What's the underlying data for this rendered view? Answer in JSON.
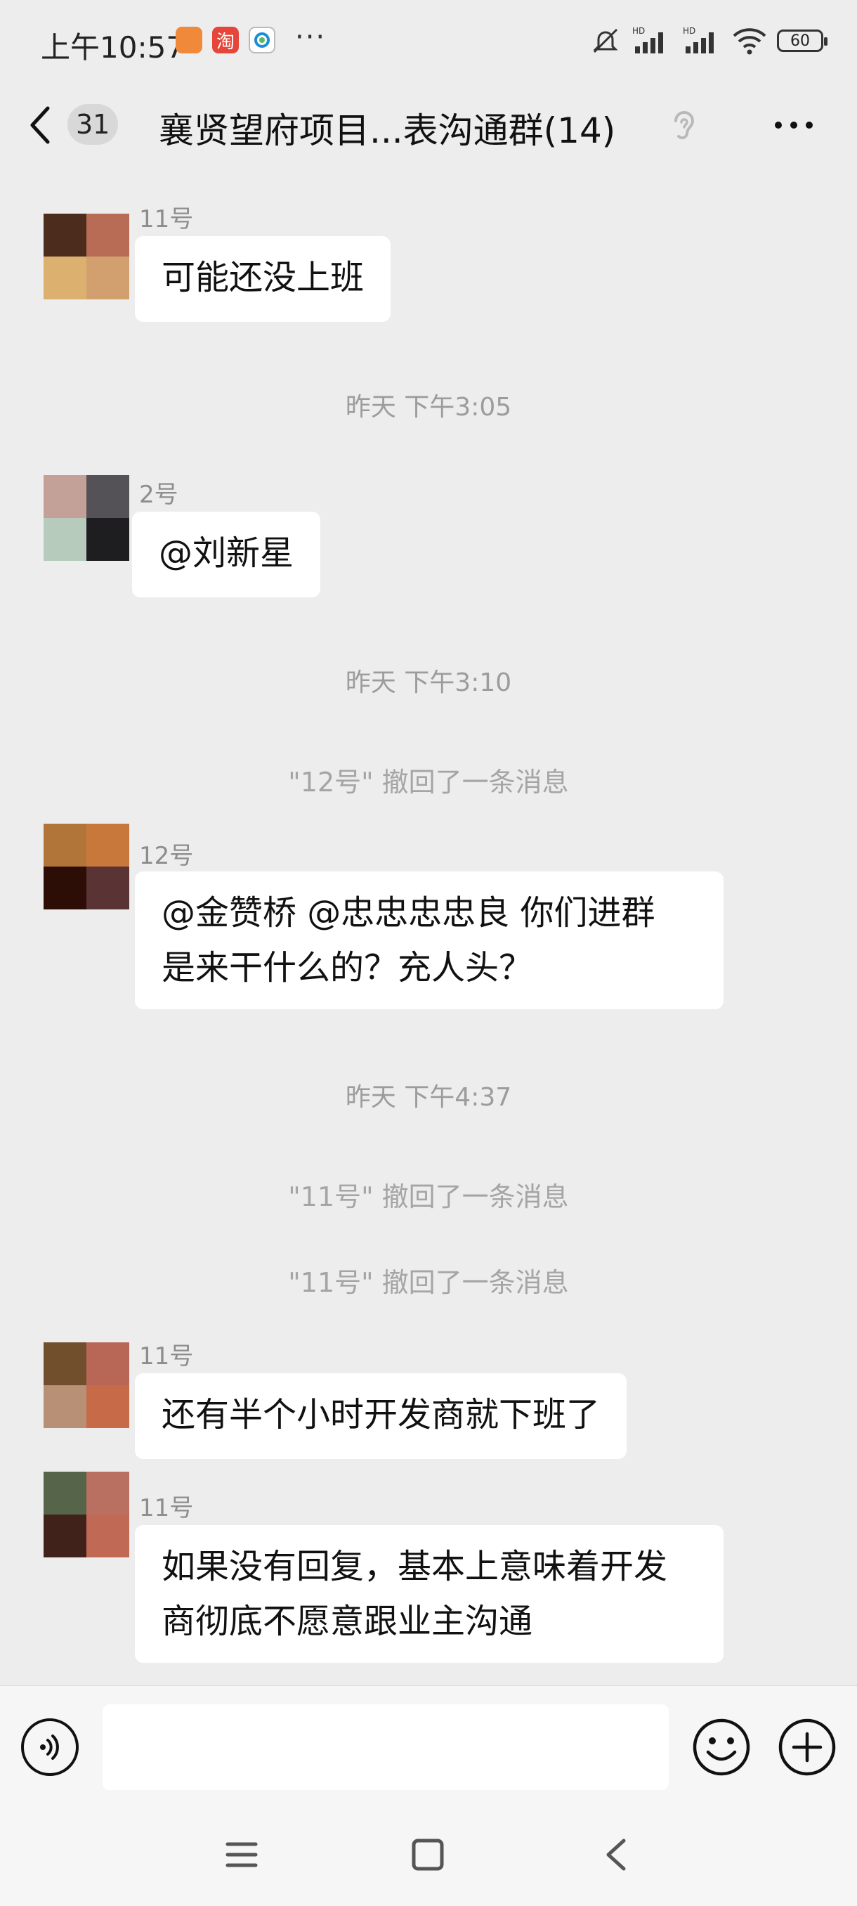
{
  "status_bar": {
    "time": "上午10:57",
    "taobao_glyph": "淘",
    "more_dots": "···",
    "battery": "60",
    "icons": [
      "mi-app-icon",
      "taobao-icon",
      "china-mobile-icon",
      "mute-bell-icon",
      "signal-hd-icon",
      "signal-hd-icon",
      "wifi-icon",
      "battery-icon"
    ]
  },
  "header": {
    "unread_count": "31",
    "title": "襄贤望府项目...表沟通群(14)"
  },
  "messages": [
    {
      "type": "text",
      "sender": "11号",
      "text": "可能还没上班",
      "avatar_colors": [
        "#4b2c1d",
        "#b86c55",
        "#dcb06f",
        "#d1a06e"
      ]
    },
    {
      "type": "time",
      "text": "昨天 下午3:05"
    },
    {
      "type": "text",
      "sender": "2号",
      "text": "@刘新星",
      "avatar_colors": [
        "#c3a198",
        "#555257",
        "#b7cbbd",
        "#1e1e20"
      ]
    },
    {
      "type": "time",
      "text": "昨天 下午3:10"
    },
    {
      "type": "system",
      "text": "\"12号\" 撤回了一条消息"
    },
    {
      "type": "text",
      "sender": "12号",
      "text_lines": [
        "@金赞桥 @忠忠忠忠良  你们进群",
        "是来干什么的？充人头？"
      ],
      "avatar_colors": [
        "#b1753a",
        "#c7783a",
        "#2c0e07",
        "#5a3334"
      ]
    },
    {
      "type": "time",
      "text": "昨天 下午4:37"
    },
    {
      "type": "system",
      "text": "\"11号\" 撤回了一条消息"
    },
    {
      "type": "system",
      "text": "\"11号\" 撤回了一条消息"
    },
    {
      "type": "text",
      "sender": "11号",
      "text": "还有半个小时开发商就下班了",
      "avatar_colors": [
        "#714f2c",
        "#b86656",
        "#b79076",
        "#c76a48"
      ]
    },
    {
      "type": "text",
      "sender": "11号",
      "text_lines": [
        "如果没有回复，基本上意味着开发",
        "商彻底不愿意跟业主沟通"
      ],
      "avatar_colors": [
        "#56644a",
        "#b97060",
        "#41221a",
        "#c06a55"
      ]
    }
  ],
  "input_bar": {
    "value": "",
    "placeholder": ""
  },
  "icons": {
    "back": "back-chevron-icon",
    "ear": "ear-icon",
    "more": "more-dots-icon",
    "voice": "voice-icon",
    "emoji": "emoji-icon",
    "plus": "plus-icon",
    "nav_menu": "menu-icon",
    "nav_home": "home-square-icon",
    "nav_back": "back-triangle-icon"
  }
}
